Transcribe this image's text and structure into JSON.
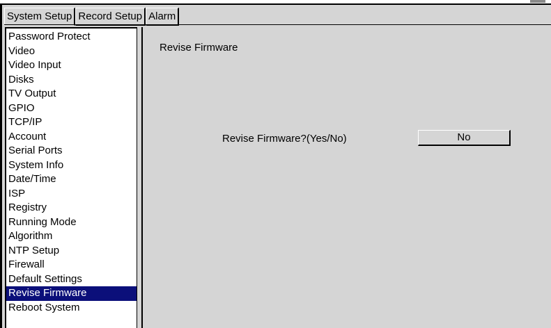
{
  "tabs": [
    {
      "label": "System Setup",
      "active": true
    },
    {
      "label": "Record Setup",
      "active": false
    },
    {
      "label": "Alarm",
      "active": false
    }
  ],
  "sidebar": {
    "items": [
      {
        "label": "Password Protect"
      },
      {
        "label": "Video"
      },
      {
        "label": "Video Input"
      },
      {
        "label": "Disks"
      },
      {
        "label": "TV Output"
      },
      {
        "label": "GPIO"
      },
      {
        "label": "TCP/IP"
      },
      {
        "label": "Account"
      },
      {
        "label": "Serial Ports"
      },
      {
        "label": "System Info"
      },
      {
        "label": "Date/Time"
      },
      {
        "label": "ISP"
      },
      {
        "label": "Registry"
      },
      {
        "label": "Running Mode"
      },
      {
        "label": "Algorithm"
      },
      {
        "label": "NTP Setup"
      },
      {
        "label": "Firewall"
      },
      {
        "label": "Default Settings"
      },
      {
        "label": "Revise Firmware",
        "selected": true
      },
      {
        "label": "Reboot System"
      }
    ]
  },
  "panel": {
    "title": "Revise Firmware",
    "prompt": "Revise Firmware?(Yes/No)",
    "answer": "No"
  },
  "colors": {
    "background": "#d5d5d5",
    "selection": "#0b0f7a",
    "list_background": "#ffffff"
  }
}
